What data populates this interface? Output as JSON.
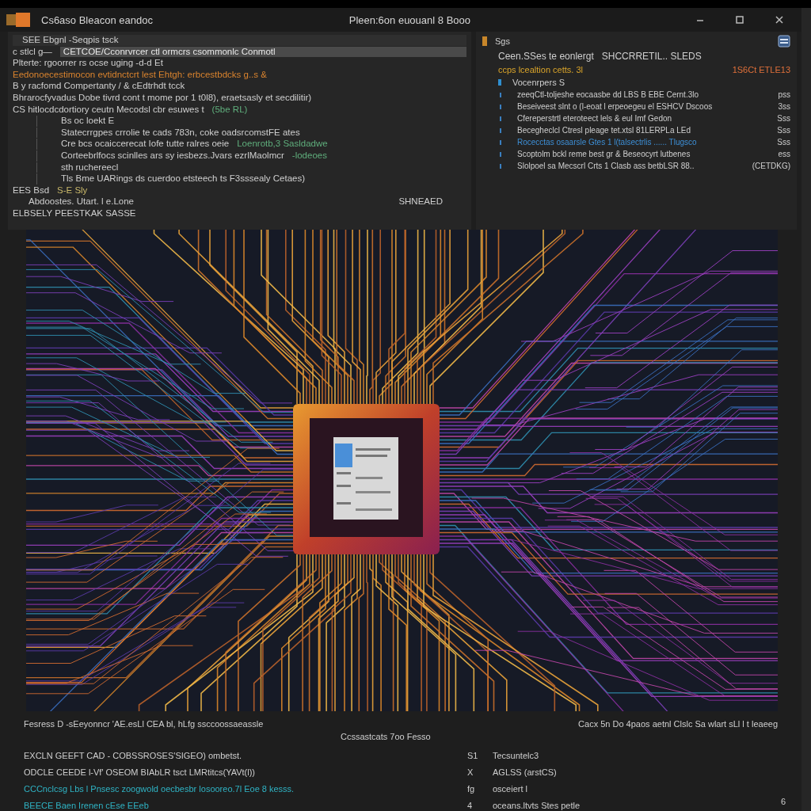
{
  "window": {
    "title": "Cs6aso Bleacon eandoc",
    "subtitle": "Pleen:6on euouanl 8 Booo"
  },
  "left_panel": {
    "lines": [
      {
        "kind": "header",
        "parts": [
          {
            "text": "SEE  Ebgnl -Seqpis tsck"
          }
        ]
      },
      {
        "kind": "highlight",
        "parts": [
          {
            "text": "c stlcl g—"
          },
          {
            "text": "CETCOE/Cconrvrcer ctl ormcrs csommonlc Conmotl"
          }
        ]
      },
      {
        "kind": "line",
        "parts": [
          {
            "text": "Plterte: rgoorrer rs ocse  uging  -d-d  Et"
          }
        ]
      },
      {
        "kind": "line",
        "parts": [
          {
            "text": "Eedonoecestimocon evtidnctcrt lest Ehtgh: erbcestbdcks g..s &",
            "color": "#d9832e"
          }
        ]
      },
      {
        "kind": "line",
        "parts": [
          {
            "text": "B y racfomd  Compertanty / & cEdtrhdt tcck"
          }
        ]
      },
      {
        "kind": "line",
        "parts": [
          {
            "text": "Bhrarocfyvadus  Dobe tivrd cont  t mome por 1 t0l8), eraetsasly  et secdilitir)"
          }
        ]
      },
      {
        "kind": "line",
        "parts": [
          {
            "text": "CS hitlocdcdortiory ceutn Mecodsl cbr   esuwes t"
          },
          {
            "text": "(5be RL)",
            "color": "#5fae7c"
          }
        ]
      },
      {
        "kind": "indent",
        "parts": [
          {
            "text": "Bs  oc  loekt E"
          }
        ]
      },
      {
        "kind": "indent",
        "parts": [
          {
            "text": "Statecrrgpes crrolie te cads 783n, coke  oadsrcomstFE ates"
          }
        ]
      },
      {
        "kind": "indent",
        "parts": [
          {
            "text": "Cre bcs ocaiccerecat Iofe tutte ralres  oeie"
          },
          {
            "text": "Loenrotb,3  Sasldadwe",
            "color": "#5fae7c"
          }
        ]
      },
      {
        "kind": "indent",
        "parts": [
          {
            "text": "Corteebrlfocs scinlles ars sy iesbezs.Jvars ezrlMaolmcr"
          },
          {
            "text": "-lodeoes",
            "color": "#5fae7c"
          }
        ]
      },
      {
        "kind": "indent",
        "parts": [
          {
            "text": "sth ruchereecl"
          }
        ]
      },
      {
        "kind": "indent",
        "parts": [
          {
            "text": "Tls  Bme UARings ds   cuerdoo etsteech  ts F3sssealy  Cetaes)"
          }
        ]
      },
      {
        "kind": "line",
        "parts": [
          {
            "text": "EES  Bsd"
          },
          {
            "text": "S-E Sly",
            "color": "#c9b86a"
          }
        ]
      },
      {
        "kind": "split",
        "parts": [
          {
            "text": "Abdoostes. Utart. l e.Lone"
          },
          {
            "text": "SHNEAED"
          }
        ]
      },
      {
        "kind": "line",
        "parts": [
          {
            "text": "ELBSELY  PEESTKAK SASSE"
          }
        ]
      }
    ]
  },
  "right_panel": {
    "title": "Sgs",
    "subtitle": [
      {
        "text": "Ceen.SSes te eonlergt"
      },
      {
        "text": "SHCCRRETIL.. SLEDS"
      }
    ],
    "section": {
      "label": "ccps lcealtion cetts. 3l",
      "value": "1S6Ct ETLE13"
    },
    "group": "Vocenrpers S",
    "rows": [
      {
        "text": "zeeqCtl-toljeshe eocaasbe dd LBS B EBE Cernt.3lo",
        "value": "pss",
        "color": "#cfcfcf"
      },
      {
        "text": "Beseiveest slnt o (l-eoat l erpeoegeu el ESHCV  Dscoos",
        "value": "3ss",
        "color": "#cfcfcf"
      },
      {
        "text": "Cfereperstrtl eteroteect lels & eul   Imf Gedon",
        "value": "Sss",
        "color": "#cfcfcf"
      },
      {
        "text": "Becegheclcl Ctresl pleage tet.xtsl 81LERPLa LEd",
        "value": "Sss",
        "color": "#cfcfcf"
      },
      {
        "text": "Rocecctas osaarsle Gtes 1 l(talsectrlis ...... Tlugsco",
        "value": "Sss",
        "color": "#3d8fd6"
      },
      {
        "text": "Scoptolm bckl reme best gr & Beseocyrt lutbenes",
        "value": "ess",
        "color": "#cfcfcf"
      },
      {
        "text": "Slolpoel sa Mecscrl Crts 1 Clasb ass betbLSR 88..",
        "value": "(CETDKG)",
        "color": "#cfcfcf"
      }
    ]
  },
  "bottom": {
    "summary": [
      {
        "text": "Fesress D  -sEeyonncr 'AE.esLl CEA  bl, hLfg  ssccoossaeassle"
      },
      {
        "text": "Cacx 5n  Do  4paos aetnl  Clslc  Sa  wlart  sLl  l  t  leaeeg"
      }
    ],
    "caption": "Ccssastcats 7oo Fesso",
    "left_lines": [
      {
        "text": "EXCLN  GEEFT CAD -  COBSSROSES'SIGEO)   ombetst.",
        "color": "#cfcfcf"
      },
      {
        "text": "ODCLE  CEEDE l-Vf' OSEOM BIAbLR  tsct   LMRtitcs(YAVt(l))",
        "color": "#cfcfcf"
      },
      {
        "text": "CCCnclcsg  Lbs l Pnsesc  zoogwold  oecbesbr  losooreo.7l  Eoe  8 kesss.",
        "color": "#2fb3c4"
      },
      {
        "text": "BEECE Baen   Irenen cEse EEeb",
        "color": "#2fb3c4"
      }
    ],
    "right_lines": [
      {
        "mark": "S1",
        "text": "Tecsuntelc3"
      },
      {
        "mark": "X",
        "text": "AGLSS  (arstCS)"
      },
      {
        "mark": "fg",
        "text": "osceiert l"
      },
      {
        "mark": "4",
        "text": "oceans.ltvts Stes petle"
      }
    ],
    "page": "6"
  }
}
